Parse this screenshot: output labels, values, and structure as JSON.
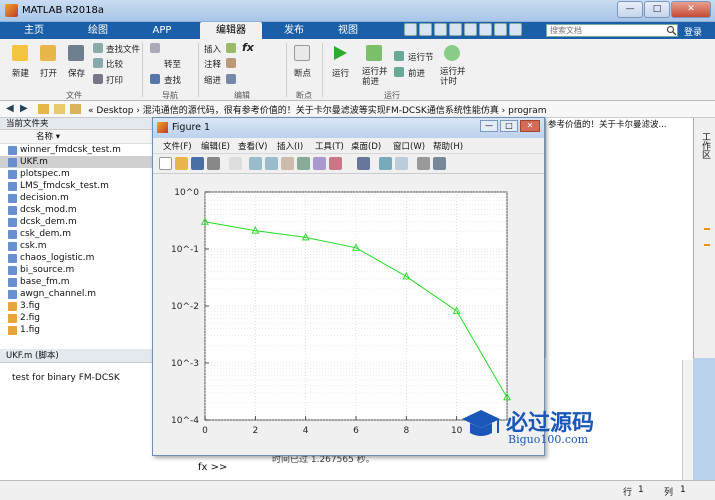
{
  "window": {
    "title": "MATLAB R2018a",
    "buttons": [
      "—",
      "□",
      "✕"
    ]
  },
  "tabs": [
    "主页",
    "绘图",
    "APP",
    "编辑器",
    "发布",
    "视图"
  ],
  "active_tab": "编辑器",
  "search": {
    "placeholder": "搜索文档"
  },
  "login": "登录",
  "ribbon": {
    "new": "新建",
    "open": "打开",
    "save": "保存",
    "find_files": "查找文件",
    "compare": "比较",
    "print": "打印",
    "goto": "转至",
    "find": "查找",
    "insert": "插入",
    "comment": "注释",
    "indent": "缩进",
    "breakpoints": "断点",
    "run": "运行",
    "run_advance": "运行并\n前进",
    "run_section": "运行节",
    "advance": "前进",
    "run_time": "运行并\n计时",
    "groups": [
      "文件",
      "导航",
      "编辑",
      "断点",
      "运行"
    ]
  },
  "address": {
    "path": "« Desktop › 混沌通信的源代码，很有参考价值的！关于卡尔曼滤波等实现FM-DCSK通信系统性能仿真 › program",
    "path_right": "参考价值的！关于卡尔曼滤波..."
  },
  "current_folder": {
    "title": "当前文件夹",
    "col_name": "名称 ▾",
    "files": [
      "winner_fmdcsk_test.m",
      "UKF.m",
      "plotspec.m",
      "LMS_fmdcsk_test.m",
      "decision.m",
      "dcsk_mod.m",
      "dcsk_dem.m",
      "csk_dem.m",
      "csk.m",
      "chaos_logistic.m",
      "bi_source.m",
      "base_fm.m",
      "awgn_channel.m",
      "3.fig",
      "2.fig",
      "1.fig"
    ],
    "selected": "UKF.m"
  },
  "details": {
    "title": "UKF.m  (脚本)",
    "text": "test for binary FM-DCSK"
  },
  "workspace_label": "工作区",
  "command": {
    "partial": "时间已过 1.267565 秒。",
    "prompt": "fx >>"
  },
  "status": {
    "line_label": "行",
    "line": "1",
    "col_label": "列",
    "col": "1"
  },
  "figure": {
    "title": "Figure 1",
    "menu": [
      "文件(F)",
      "编辑(E)",
      "查看(V)",
      "插入(I)",
      "工具(T)",
      "桌面(D)",
      "窗口(W)",
      "帮助(H)"
    ]
  },
  "chart_data": {
    "type": "line",
    "x": [
      0,
      2,
      4,
      6,
      8,
      10,
      12
    ],
    "series": [
      {
        "values": [
          0.3,
          0.21,
          0.16,
          0.105,
          0.033,
          0.0082,
          0.00025
        ],
        "color": "#22dd22",
        "marker": "triangle"
      }
    ],
    "xlim": [
      0,
      12
    ],
    "ylim_log": [
      0.0001,
      1
    ],
    "yscale": "log",
    "xticks": [
      "0",
      "2",
      "4",
      "6",
      "8",
      "10"
    ],
    "yticks": [
      "10^0",
      "10^-1",
      "10^-2",
      "10^-3",
      "10^-4"
    ],
    "grid": true
  },
  "watermark": {
    "cn": "必过源码",
    "en": "Biguo100.com"
  }
}
